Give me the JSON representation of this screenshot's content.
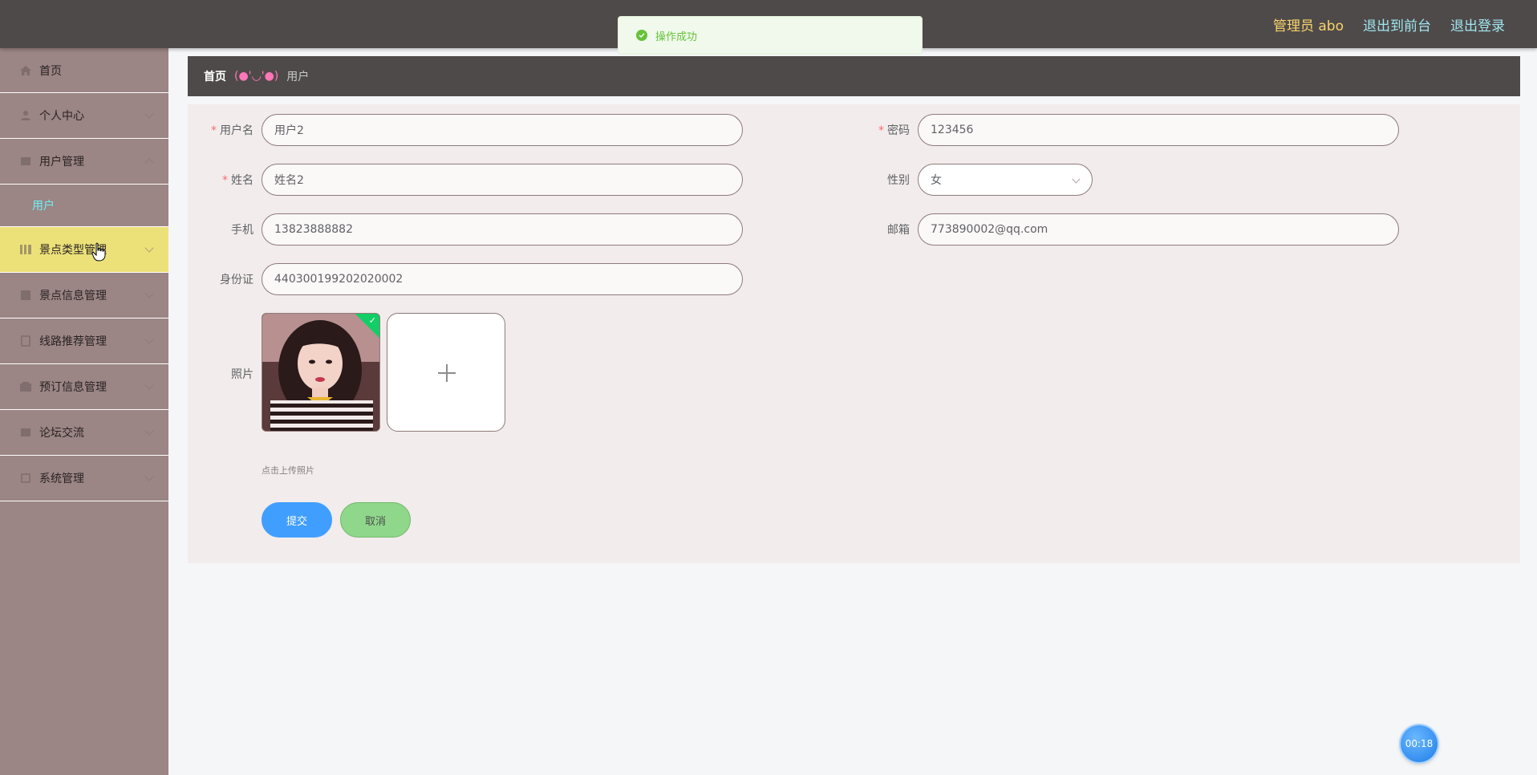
{
  "header": {
    "admin_label": "管理员 abo",
    "front_link": "退出到前台",
    "logout_link": "退出登录"
  },
  "toast": {
    "message": "操作成功",
    "icon": "success-check-icon",
    "color": "#67c23a"
  },
  "sidebar": {
    "items": [
      {
        "label": "首页",
        "icon": "home-icon"
      },
      {
        "label": "个人中心",
        "icon": "user-icon"
      },
      {
        "label": "用户管理",
        "icon": "users-icon"
      },
      {
        "label": "景点类型管理",
        "icon": "category-icon",
        "active": true
      },
      {
        "label": "景点信息管理",
        "icon": "info-icon"
      },
      {
        "label": "线路推荐管理",
        "icon": "route-icon"
      },
      {
        "label": "预订信息管理",
        "icon": "booking-icon"
      },
      {
        "label": "论坛交流",
        "icon": "forum-icon"
      },
      {
        "label": "系统管理",
        "icon": "settings-icon"
      }
    ],
    "sub_item": "用户",
    "active_color": "#ece179"
  },
  "breadcrumb": {
    "home": "首页",
    "separator": "(●'◡'●)",
    "current": "用户"
  },
  "form": {
    "username_label": "用户名",
    "username_value": "用户2",
    "password_label": "密码",
    "password_value": "123456",
    "name_label": "姓名",
    "name_value": "姓名2",
    "gender_label": "性别",
    "gender_value": "女",
    "phone_label": "手机",
    "phone_value": "13823888882",
    "email_label": "邮箱",
    "email_value": "773890002@qq.com",
    "idcard_label": "身份证",
    "idcard_value": "440300199202020002",
    "photo_label": "照片",
    "upload_hint": "点击上传照片",
    "submit": "提交",
    "cancel": "取消"
  },
  "timer": "00:18"
}
